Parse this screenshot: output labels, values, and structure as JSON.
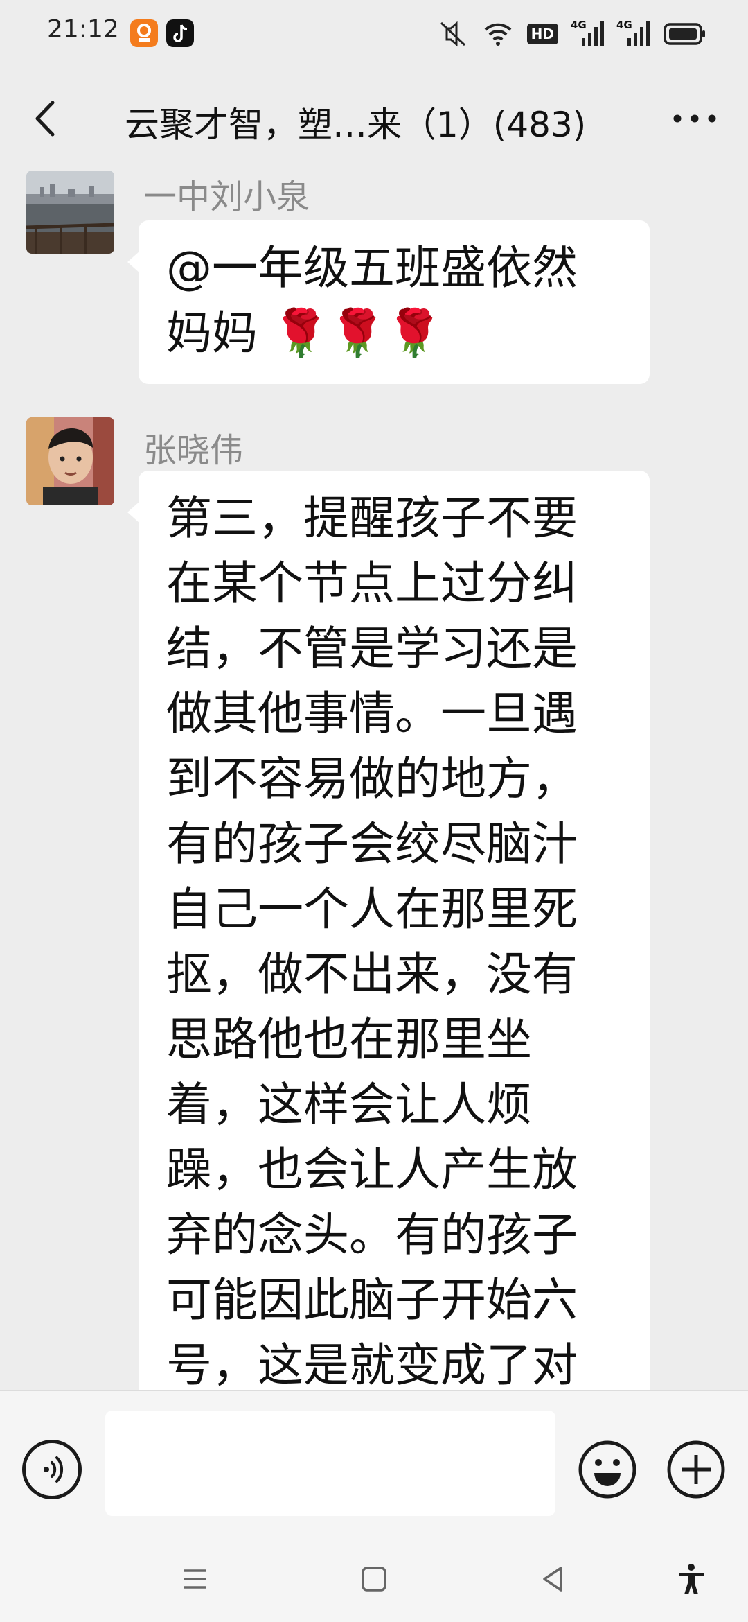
{
  "status_bar": {
    "time": "21:12",
    "hd_label": "HD",
    "network_label_1": "4G",
    "network_label_2": "4G",
    "icons": [
      "app-icon-orange",
      "tiktok-icon",
      "mute-icon",
      "wifi-icon",
      "hd-badge",
      "signal-icon",
      "signal-icon",
      "battery-icon"
    ]
  },
  "header": {
    "title": "云聚才智，塑…来（1）(483)",
    "back_icon": "chevron-left-icon",
    "more_icon": "more-dots-icon"
  },
  "messages": [
    {
      "sender": "一中刘小泉",
      "text": "@一年级五班盛依然妈妈 🌹🌹🌹",
      "avatar": "lake-skyline-avatar"
    },
    {
      "sender": "张晓伟",
      "text": "第三，提醒孩子不要在某个节点上过分纠结，不管是学习还是做其他事情。一旦遇到不容易做的地方，有的孩子会绞尽脑汁自己一个人在那里死抠，做不出来，没有思路他也在那里坐着，这样会让人烦躁，也会让人产生放弃的念头。有的孩子可能因此脑子开始六号，这是就变成了对时间",
      "avatar": "child-photo-avatar"
    }
  ],
  "input_bar": {
    "voice_icon": "voice-input-icon",
    "input_value": "",
    "emoji_icon": "emoji-icon",
    "plus_icon": "plus-icon"
  },
  "nav_bar": {
    "icons": [
      "menu-icon",
      "home-icon",
      "back-triangle-icon",
      "accessibility-icon"
    ]
  }
}
